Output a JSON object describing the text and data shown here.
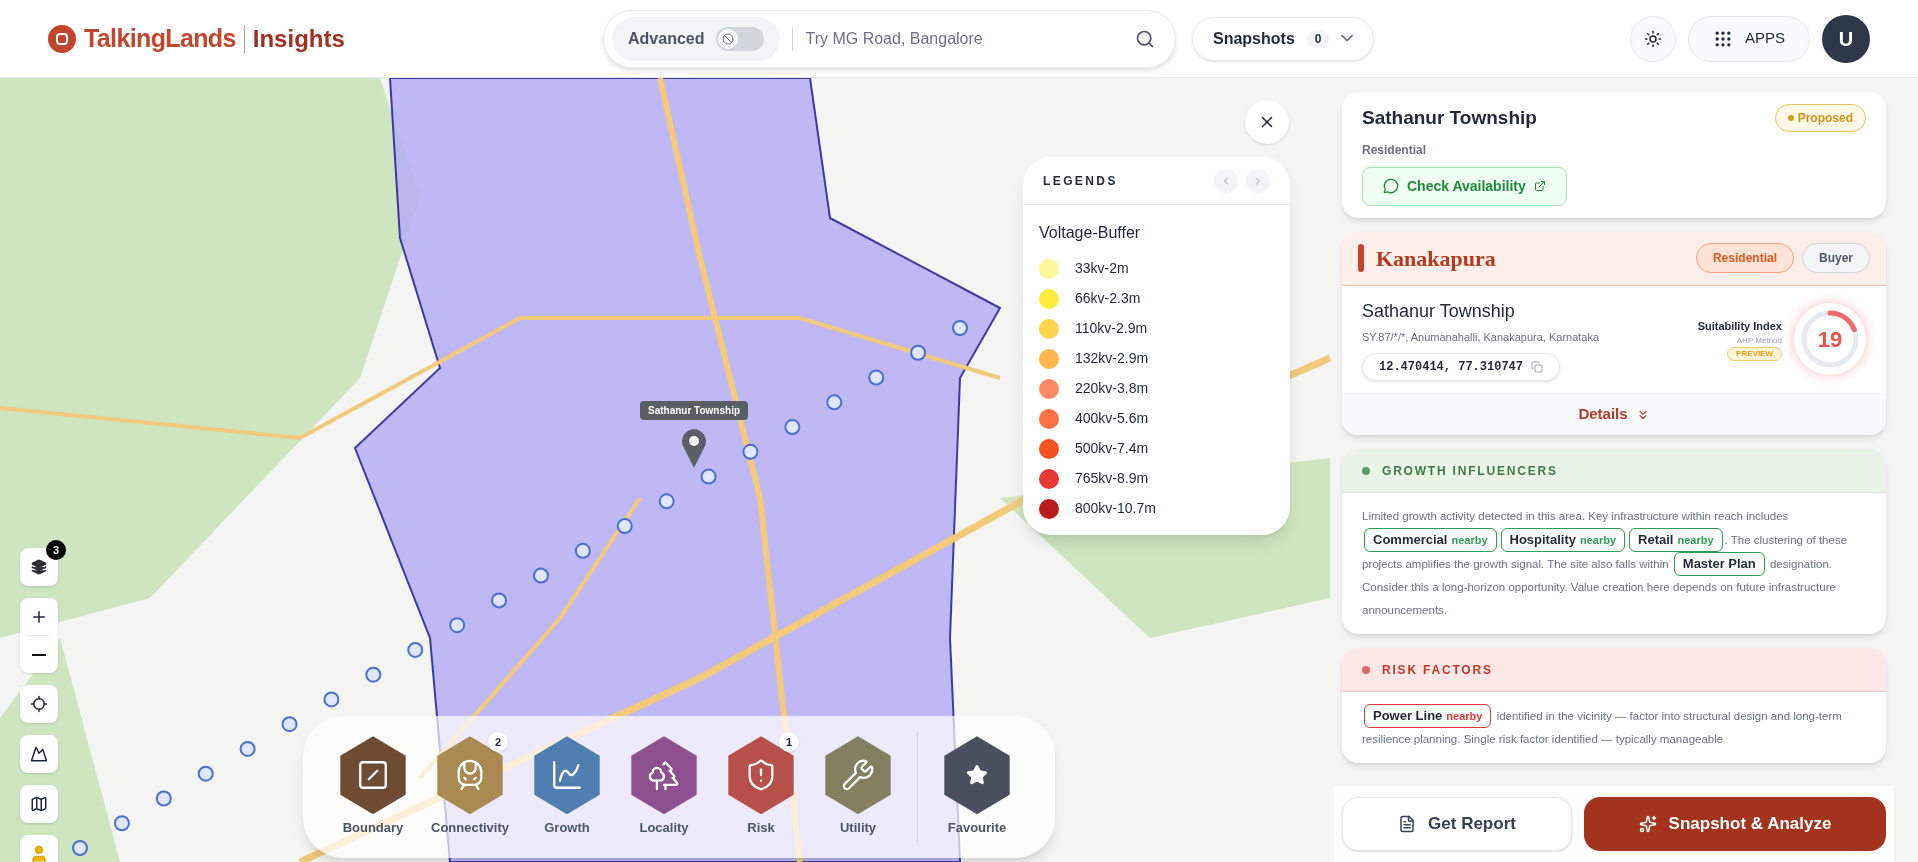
{
  "header": {
    "brand": "TalkingLands",
    "product": "Insights",
    "advanced": {
      "label": "Advanced",
      "on": false
    },
    "search": {
      "placeholder": "Try MG Road, Bangalore"
    },
    "snapshots": {
      "label": "Snapshots",
      "count": "0"
    },
    "apps": "APPS",
    "avatar": "U"
  },
  "map": {
    "layers_badge": "3",
    "marker_label": "Sathanur Township"
  },
  "legend": {
    "title": "LEGENDS",
    "group": "Voltage-Buffer",
    "items": [
      {
        "label": "33kv-2m",
        "color": "#fff59d"
      },
      {
        "label": "66kv-2.3m",
        "color": "#ffeb3b"
      },
      {
        "label": "110kv-2.9m",
        "color": "#ffd54f"
      },
      {
        "label": "132kv-2.9m",
        "color": "#ffb74d"
      },
      {
        "label": "220kv-3.8m",
        "color": "#ff8a65"
      },
      {
        "label": "400kv-5.6m",
        "color": "#ff7043"
      },
      {
        "label": "500kv-7.4m",
        "color": "#f4511e"
      },
      {
        "label": "765kv-8.9m",
        "color": "#e53935"
      },
      {
        "label": "800kv-10.7m",
        "color": "#b71c1c"
      }
    ]
  },
  "toolbar": {
    "items": [
      {
        "label": "Boundary",
        "color": "#6d4c33"
      },
      {
        "label": "Connectivity",
        "color": "#a88a52",
        "badge": "2"
      },
      {
        "label": "Growth",
        "color": "#4f7fb0"
      },
      {
        "label": "Locality",
        "color": "#8e4f8e"
      },
      {
        "label": "Risk",
        "color": "#b5504a",
        "badge": "1"
      },
      {
        "label": "Utility",
        "color": "#84805f"
      }
    ],
    "favourite": {
      "label": "Favourite",
      "color": "#4a5060"
    }
  },
  "panel": {
    "property": {
      "title": "Sathanur Township",
      "status": "Proposed",
      "type": "Residential",
      "action": "Check Availability"
    },
    "location": {
      "region": "Kanakapura",
      "tags": [
        {
          "label": "Residential",
          "selected": true
        },
        {
          "label": "Buyer",
          "selected": false
        }
      ],
      "name": "Sathanur Township",
      "address": "SY.87/*/*, Anumanahalli, Kanakapura, Karnataka",
      "coords": "12.470414, 77.310747",
      "index_label": "Suitability Index",
      "method": "AHP Method",
      "preview": "PREVIEW",
      "score": "19",
      "level": 0.19,
      "details": "Details"
    },
    "sections": [
      {
        "kind": "growth",
        "title": "GROWTH INFLUENCERS",
        "segments": [
          {
            "kind": "text",
            "text": "Limited growth activity detected in this area. Key infrastructure within reach includes "
          },
          {
            "kind": "chip",
            "label": "Commercial",
            "note": "nearby"
          },
          {
            "kind": "chip",
            "label": "Hospitality",
            "note": "nearby"
          },
          {
            "kind": "chip",
            "label": "Retail",
            "note": "nearby"
          },
          {
            "kind": "text",
            "text": ". The clustering of these projects amplifies the growth signal. The site also falls within "
          },
          {
            "kind": "chip",
            "label": "Master Plan"
          },
          {
            "kind": "text",
            "text": " designation. Consider this a long-horizon opportunity. Value creation here depends on future infrastructure announcements."
          }
        ]
      },
      {
        "kind": "risk",
        "title": "RISK FACTORS",
        "segments": [
          {
            "kind": "chip",
            "label": "Power Line",
            "note": "nearby"
          },
          {
            "kind": "text",
            "text": " identified in the vicinity — factor into structural design and long-term resilience planning. Single risk factor identified — typically manageable"
          }
        ]
      }
    ],
    "buttons": {
      "report": "Get Report",
      "analyze": "Snapshot & Analyze"
    }
  }
}
